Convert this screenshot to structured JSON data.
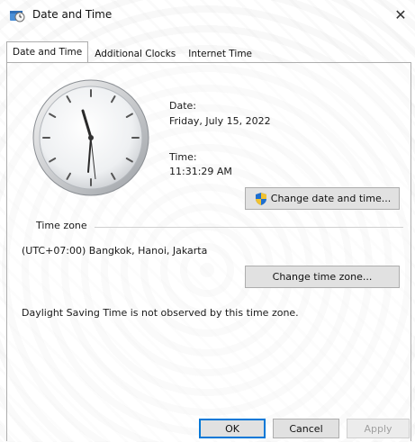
{
  "window": {
    "title": "Date and Time"
  },
  "tabs": [
    {
      "label": "Date and Time"
    },
    {
      "label": "Additional Clocks"
    },
    {
      "label": "Internet Time"
    }
  ],
  "datetime": {
    "date_label": "Date:",
    "date_value": "Friday, July 15, 2022",
    "time_label": "Time:",
    "time_value": "11:31:29 AM",
    "change_button": "Change date and time..."
  },
  "timezone": {
    "group_title": "Time zone",
    "value": "(UTC+07:00) Bangkok, Hanoi, Jakarta",
    "change_button": "Change time zone...",
    "dst_note": "Daylight Saving Time is not observed by this time zone."
  },
  "footer": {
    "ok": "OK",
    "cancel": "Cancel",
    "apply": "Apply"
  },
  "icons": {
    "close": "close-icon",
    "title": "date-time-app-icon",
    "shield": "uac-shield-icon"
  },
  "colors": {
    "accent": "#0078d7",
    "uac_blue": "#1e6fd0",
    "uac_yellow": "#f2c230"
  }
}
